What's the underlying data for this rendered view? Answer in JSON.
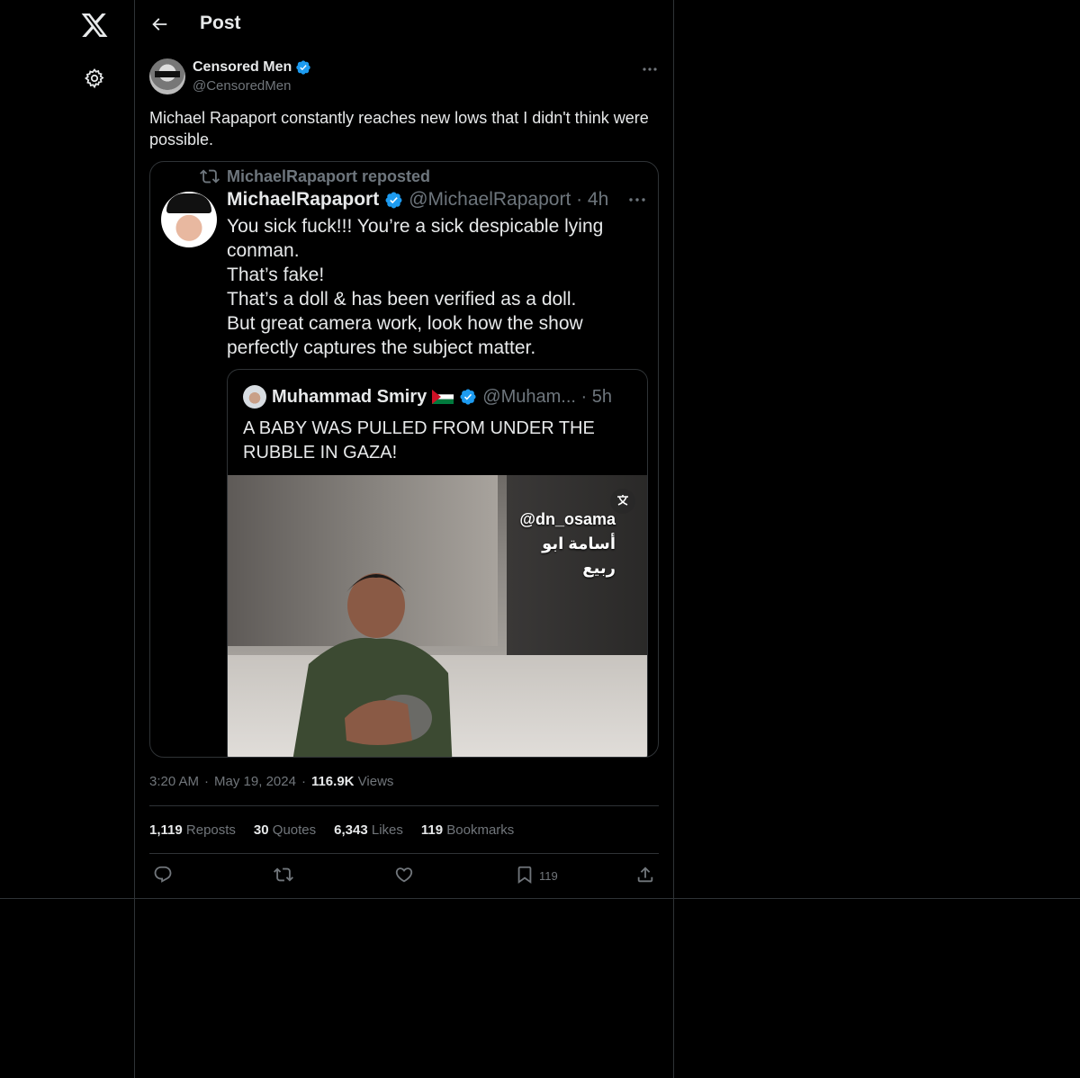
{
  "nav": {
    "logo_icon": "x-logo-icon",
    "settings_icon": "gear-icon"
  },
  "header": {
    "back_icon": "arrow-left-icon",
    "title": "Post"
  },
  "post": {
    "author_name": "Censored Men",
    "author_handle": "@CensoredMen",
    "verified": true,
    "text": "Michael Rapaport constantly reaches new lows that I didn't think were possible.",
    "media": {
      "repost_label": "MichaelRapaport reposted",
      "name": "MichaelRapaport",
      "handle_time": "@MichaelRapaport · 4h",
      "lines": [
        "You sick fuck!!! You’re a sick despicable lying",
        "conman.",
        "That’s fake!",
        "That’s a doll & has been verified as a doll.",
        "But great camera work, look how the show",
        "perfectly captures the subject matter."
      ],
      "quote": {
        "name": "Muhammad Smiry",
        "handle_time": "@Muham... · 5h",
        "text": "A BABY WAS PULLED FROM UNDER THE RUBBLE IN GAZA!",
        "watermark_handle": "@dn_osama",
        "watermark_arabic": "أسامة ابو ربيع"
      }
    },
    "time": "3:20 AM",
    "date": "May 19, 2024",
    "views_count": "116.9K",
    "views_label": "Views",
    "stats": [
      {
        "count": "1,119",
        "label": "Reposts"
      },
      {
        "count": "30",
        "label": "Quotes"
      },
      {
        "count": "6,343",
        "label": "Likes"
      },
      {
        "count": "119",
        "label": "Bookmarks"
      }
    ],
    "actions": {
      "reply_icon": "reply-icon",
      "repost_icon": "repost-icon",
      "like_icon": "heart-icon",
      "bookmark_icon": "bookmark-icon",
      "bookmark_count": "119",
      "share_icon": "share-icon"
    }
  },
  "colors": {
    "background": "#000000",
    "border": "#2f3336",
    "muted": "#71767b",
    "text": "#e7e9ea",
    "verified": "#1d9bf0"
  }
}
